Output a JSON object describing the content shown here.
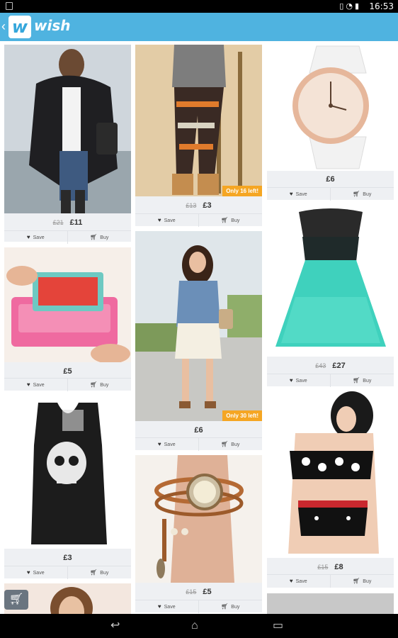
{
  "status_bar": {
    "time": "16:53",
    "icons": [
      "notification-icon",
      "wifi-icon",
      "battery-icon"
    ]
  },
  "app_bar": {
    "back_glyph": "‹",
    "logo_letter": "w",
    "logo_text": "wish"
  },
  "colors": {
    "app_bar": "#4fb3e0",
    "badge": "#f5a623",
    "card_bg": "#eef0f3"
  },
  "actions": {
    "save": "Save",
    "buy": "Buy"
  },
  "products": [
    {
      "old_price": "£21",
      "price": "£11",
      "badge": "",
      "image": "woman in black cardigan and jeans"
    },
    {
      "old_price": "£13",
      "price": "£3",
      "badge": "Only 16 left!",
      "image": "patterned leggings with boots"
    },
    {
      "old_price": "",
      "price": "£6",
      "badge": "",
      "image": "rose gold watch with white strap"
    },
    {
      "old_price": "",
      "price": "£5",
      "badge": "",
      "image": "pink wallet phone case"
    },
    {
      "old_price": "",
      "price": "£6",
      "badge": "Only 30 left!",
      "image": "woman in denim shirt and lace shorts"
    },
    {
      "old_price": "£43",
      "price": "£27",
      "badge": "",
      "image": "strapless teal tulle dress"
    },
    {
      "old_price": "",
      "price": "£3",
      "badge": "",
      "image": "black skull print tank top"
    },
    {
      "old_price": "£15",
      "price": "£5",
      "badge": "",
      "image": "wrap leather bracelet watch"
    },
    {
      "old_price": "£15",
      "price": "£8",
      "badge": "",
      "image": "polka dot high-waist bikini"
    }
  ],
  "nav": {
    "back_icon": "back-icon",
    "home_icon": "home-icon",
    "recents_icon": "recents-icon"
  }
}
